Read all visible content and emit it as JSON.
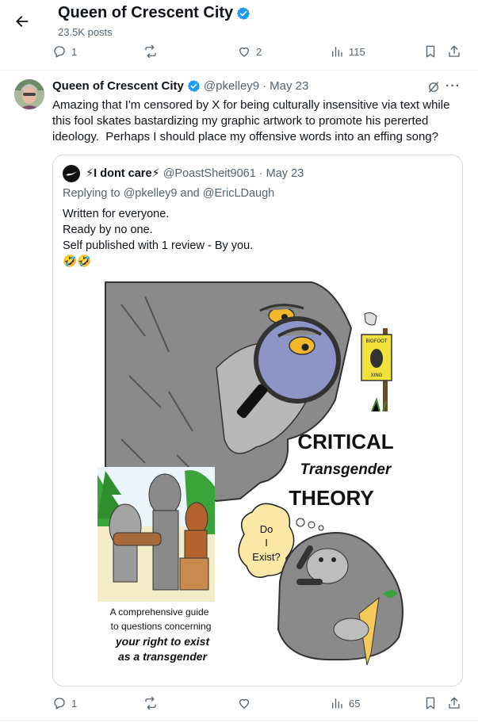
{
  "header": {
    "title": "Queen of Crescent City",
    "posts": "23.5K posts"
  },
  "prev_actions": {
    "reply": "1",
    "retweet": "",
    "like": "2",
    "views": "115"
  },
  "tweet": {
    "name": "Queen of Crescent City",
    "handle": "@pkelley9",
    "sep": "·",
    "date": "May 23",
    "text": "Amazing that I'm censored by X for being culturally insensitive via text while this fool skates bastardizing my graphic artwork to promote his pererted ideology.  Perhaps I should place my offensive words into an effing song?"
  },
  "quote": {
    "name": "⚡I dont care⚡",
    "handle": "@PoastSheit9061",
    "sep": "·",
    "date": "May 23",
    "replying_prefix": "Replying to ",
    "reply_user1": "@pkelley9",
    "reply_and": " and ",
    "reply_user2": "@EricLDaugh",
    "text": "Written for everyone.\nReady by no one.\nSelf published with 1 review - By you.\n🤣🤣",
    "book": {
      "title_line1": "CRITICAL",
      "title_line2": "Transgender",
      "title_line3": "THEORY",
      "sign_line1": "BIGFOOT",
      "sign_line2": "XING",
      "bubble_line1": "Do",
      "bubble_line2": "I",
      "bubble_line3": "Exist?",
      "caption_line1": "A comprehensive guide",
      "caption_line2": "to questions concerning",
      "caption_line3": "your right to exist",
      "caption_line4": "as a transgender"
    }
  },
  "tweet_actions": {
    "reply": "1",
    "retweet": "",
    "like": "",
    "views": "65"
  },
  "colors": {
    "verified": "#1d9bf0",
    "muted": "#536471",
    "border": "#cfd9de"
  }
}
